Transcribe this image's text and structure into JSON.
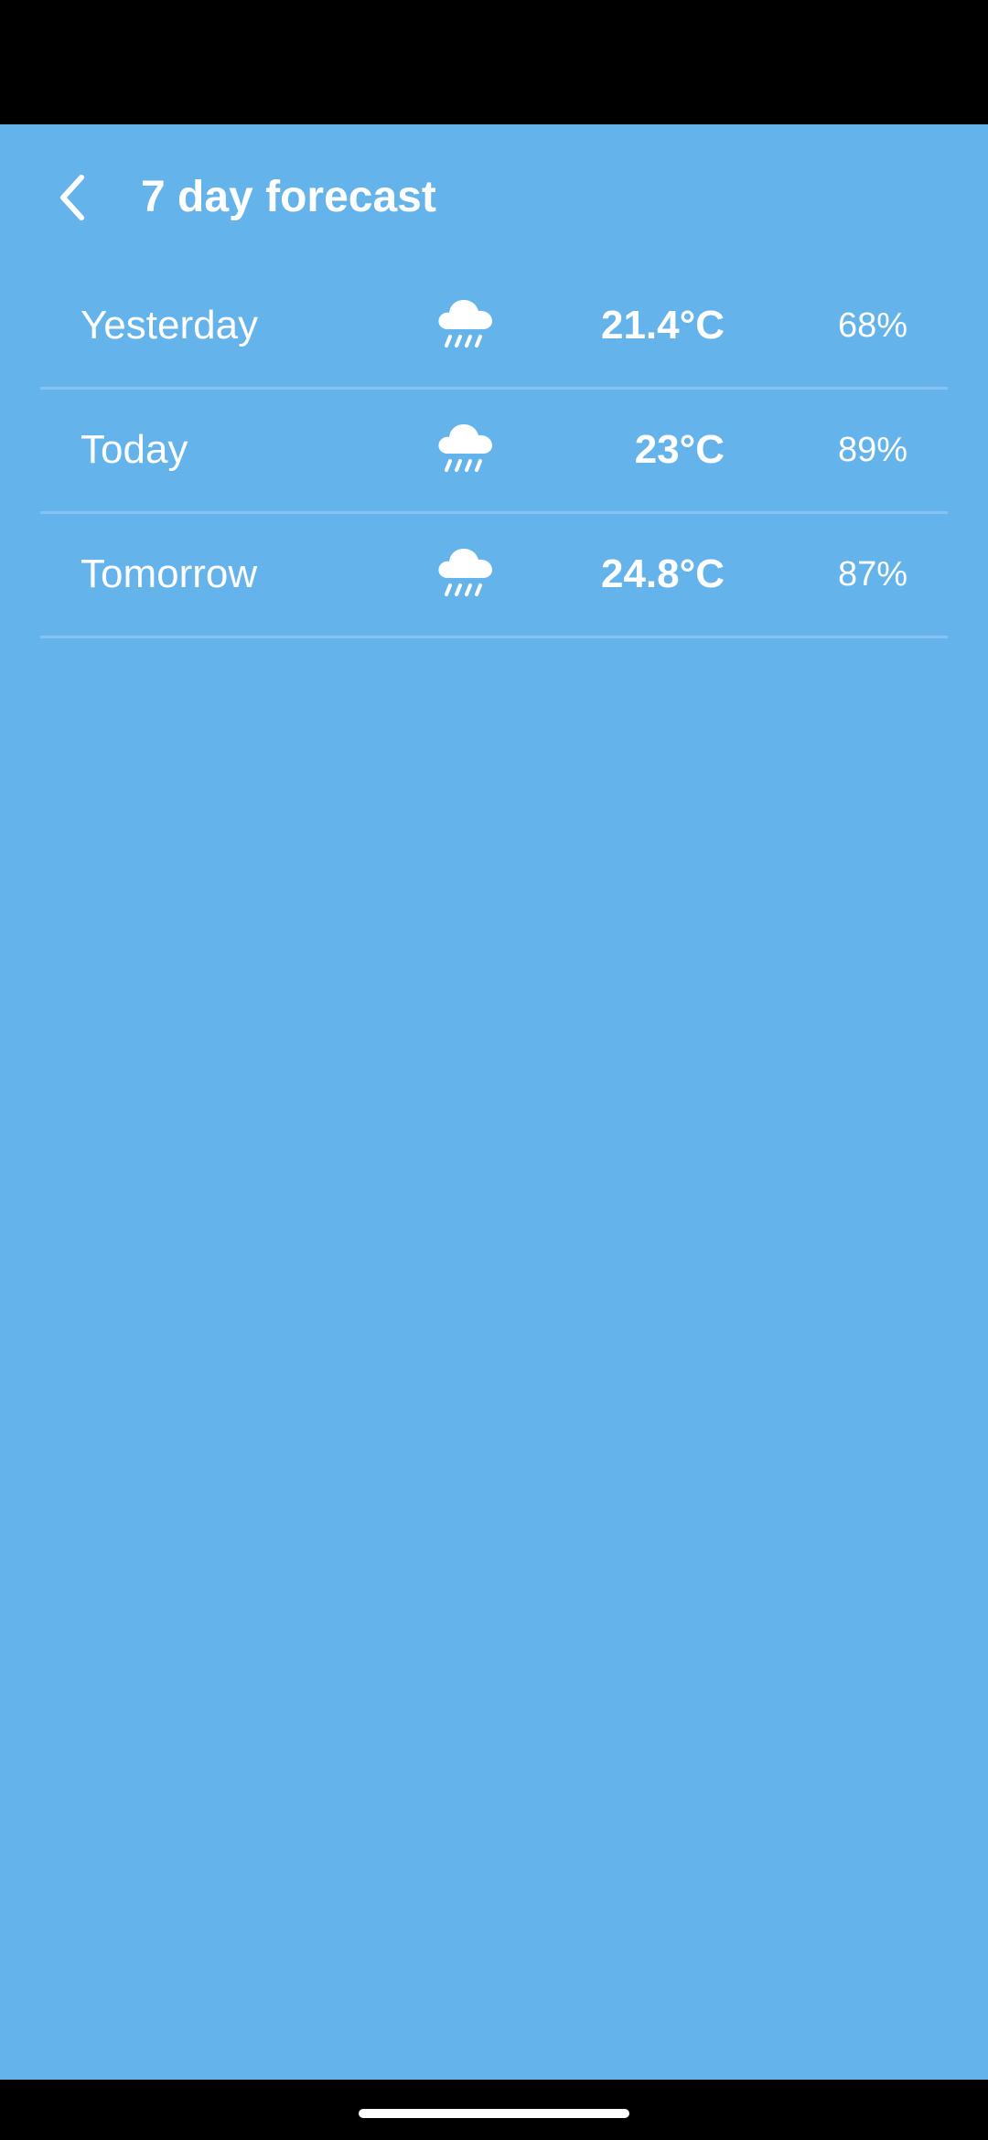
{
  "toolbar": {
    "back_icon": "chevron-left-icon",
    "title": "7 day forecast"
  },
  "forecast": [
    {
      "day": "Yesterday",
      "icon": "rain-cloud-icon",
      "temperature": "21.4°C",
      "humidity": "68%"
    },
    {
      "day": "Today",
      "icon": "rain-cloud-icon",
      "temperature": "23°C",
      "humidity": "89%"
    },
    {
      "day": "Tomorrow",
      "icon": "rain-cloud-icon",
      "temperature": "24.8°C",
      "humidity": "87%"
    }
  ],
  "colors": {
    "background": "#64b3eb",
    "divider": "#86c3f3",
    "text": "#ffffff",
    "system_bars": "#000000"
  }
}
